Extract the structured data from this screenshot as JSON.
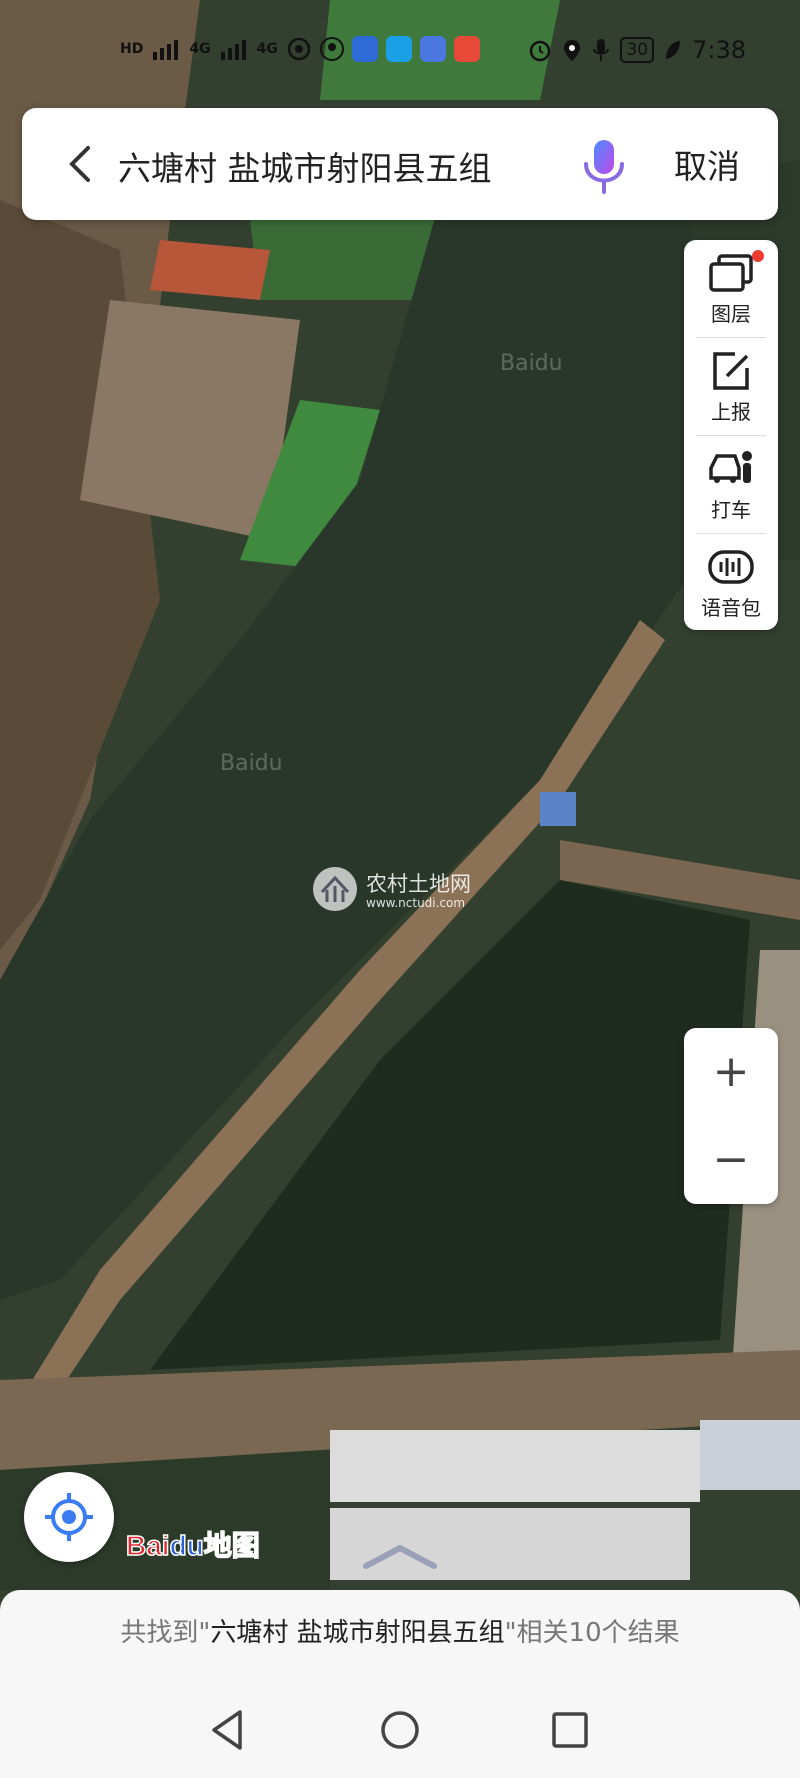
{
  "status_bar": {
    "left_labels": [
      "HD",
      "4G",
      "4G"
    ],
    "battery": "30",
    "time": "7:38",
    "app_icon_colors": [
      "#2f6bd6",
      "#1aa0e6",
      "#4a78e0",
      "#e84a3a"
    ]
  },
  "search": {
    "query": "六塘村 盐城市射阳县五组",
    "cancel_label": "取消",
    "back_icon": "chevron-left-icon",
    "mic_icon": "microphone-icon"
  },
  "tools": [
    {
      "label": "图层",
      "icon": "layers-icon",
      "badge": true
    },
    {
      "label": "上报",
      "icon": "report-edit-icon",
      "badge": false
    },
    {
      "label": "打车",
      "icon": "taxi-icon",
      "badge": false
    },
    {
      "label": "语音包",
      "icon": "voice-pack-icon",
      "badge": false
    }
  ],
  "zoom": {
    "in_label": "+",
    "out_label": "−"
  },
  "map": {
    "watermark_text": "Baidu",
    "site_watermark": {
      "title": "农村土地网",
      "url": "www.nctudi.com"
    },
    "logo": {
      "bai": "Bai",
      "du": "du",
      "ditu": "地图"
    }
  },
  "result": {
    "prefix": "共找到\"",
    "highlight": "六塘村 盐城市射阳县五组",
    "suffix": "\"相关10个结果"
  },
  "colors": {
    "accent": "#3a7cf2",
    "badge": "#ee3b2f",
    "logo_red": "#e0262c",
    "logo_blue": "#2d5fd8"
  }
}
